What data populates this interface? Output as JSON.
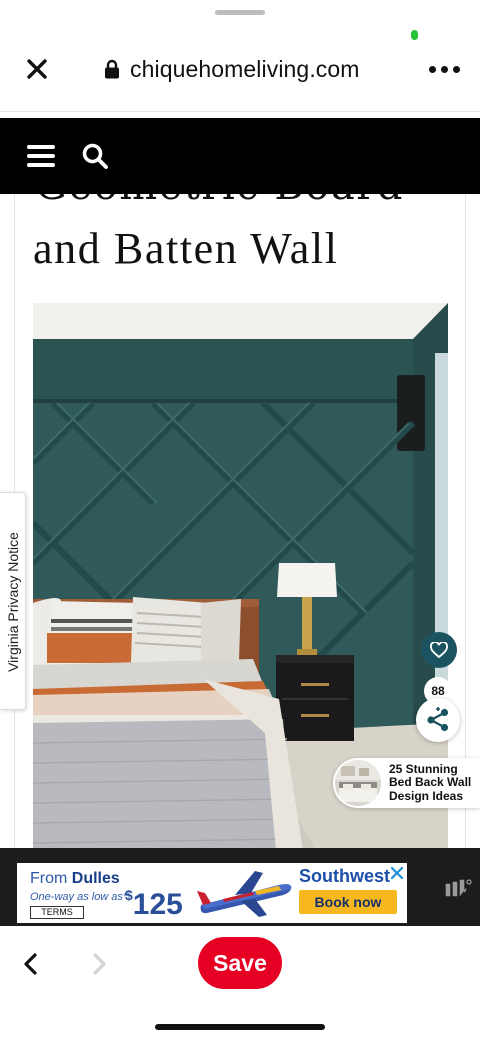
{
  "browser": {
    "url": "chiquehomeliving.com",
    "icons": {
      "close": "close-icon",
      "lock": "lock-icon",
      "more": "more-horizontal-icon"
    }
  },
  "site_nav": {
    "icons": {
      "menu": "hamburger-menu-icon",
      "search": "search-icon"
    }
  },
  "article": {
    "title_partial": "Geometric Board",
    "title_line": "and Batten Wall",
    "hero_image": "dark teal geometric board and batten bedroom wall with bed and nightstand lamp"
  },
  "side_tab": {
    "label": "Virginia Privacy Notice"
  },
  "share_widget": {
    "count": "88",
    "colors": {
      "heart_bg": "#1b5460"
    },
    "icons": {
      "heart": "heart-icon",
      "share": "share-icon"
    }
  },
  "recommendation": {
    "line1": "25 Stunning",
    "line2": "Bed Back Wall",
    "line3": "Design Ideas"
  },
  "ad": {
    "from": "From ",
    "city": "Dulles",
    "oneway": "One-way as low as*",
    "terms": "TERMS",
    "currency": "$",
    "price": "125",
    "brand": "Southwest",
    "cta": "Book now",
    "colors": {
      "brand": "#1c4fa7",
      "cta": "#f7b81f"
    }
  },
  "bottom_bar": {
    "save_label": "Save",
    "colors": {
      "save": "#e60023"
    },
    "icons": {
      "back": "chevron-left-icon",
      "forward": "chevron-right-icon"
    }
  }
}
